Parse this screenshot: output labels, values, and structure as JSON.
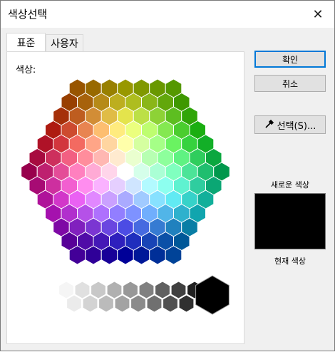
{
  "window": {
    "title": "색상선택"
  },
  "tabs": [
    {
      "label": "표준",
      "active": true
    },
    {
      "label": "사용자",
      "active": false
    }
  ],
  "panel": {
    "color_label": "색상:"
  },
  "buttons": {
    "ok": "확인",
    "cancel": "취소",
    "pick": "선택(S)..."
  },
  "labels": {
    "new_color": "새로운 색상",
    "current_color": "현재 색상"
  },
  "colors": {
    "new_color": "#000000",
    "current_color": "#000000"
  }
}
